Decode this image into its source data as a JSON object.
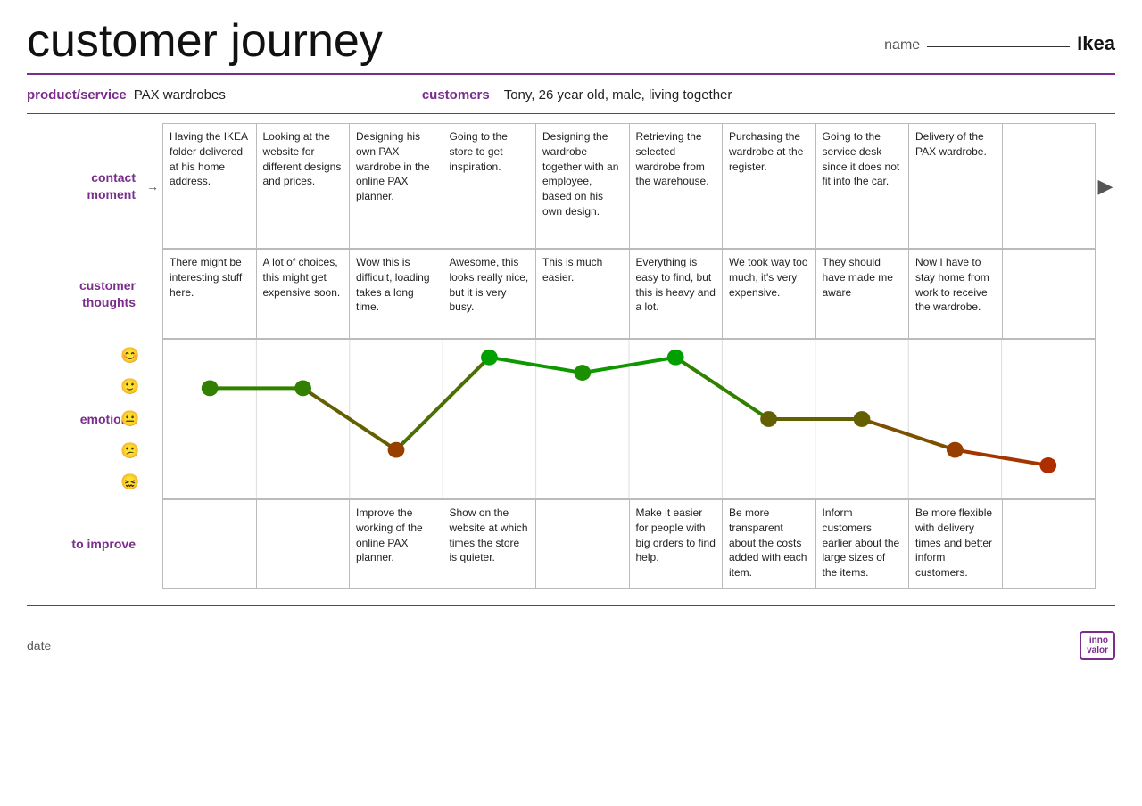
{
  "header": {
    "title": "customer journey",
    "name_label": "name",
    "name_value": "Ikea"
  },
  "meta": {
    "product_label": "product/service",
    "product_value": "PAX wardrobes",
    "customers_label": "customers",
    "customers_value": "Tony, 26 year old, male, living together"
  },
  "contact_moment_label": "contact\nmoment",
  "customer_thoughts_label": "customer\nthoughts",
  "emotions_label": "emotions",
  "to_improve_label": "to improve",
  "columns": [
    {
      "contact": "Having the IKEA folder delivered at his home address.",
      "thoughts": "There might be interesting stuff here.",
      "improve": ""
    },
    {
      "contact": "Looking at the website for different designs and prices.",
      "thoughts": "A lot of choices, this might get expensive soon.",
      "improve": ""
    },
    {
      "contact": "Designing his own PAX wardrobe in the online PAX planner.",
      "thoughts": "Wow this is difficult, loading takes a long time.",
      "improve": "Improve the working of the online PAX planner."
    },
    {
      "contact": "Going to the store to get inspiration.",
      "thoughts": "Awesome, this looks really nice, but it is very busy.",
      "improve": "Show on the website at which times the store is quieter."
    },
    {
      "contact": "Designing the wardrobe together with an employee, based on his own design.",
      "thoughts": "This is much easier.",
      "improve": ""
    },
    {
      "contact": "Retrieving the selected wardrobe from the warehouse.",
      "thoughts": "Everything is easy to find, but this is heavy and a lot.",
      "improve": "Make it easier for people with big orders to find help."
    },
    {
      "contact": "Purchasing the wardrobe at the register.",
      "thoughts": "We took way too much, it's very expensive.",
      "improve": "Be more transparent about the costs added with each item."
    },
    {
      "contact": "Going to the service desk since it does not fit into the car.",
      "thoughts": "They should have made me aware",
      "improve": "Inform customers earlier about the large sizes of the items."
    },
    {
      "contact": "Delivery of the PAX wardrobe.",
      "thoughts": "Now I have to stay home from work to receive the wardrobe.",
      "improve": "Be more flexible with delivery times and better inform customers."
    },
    {
      "contact": "",
      "thoughts": "",
      "improve": ""
    }
  ],
  "emotions": {
    "levels": [
      "😊",
      "🙂",
      "😐",
      "😕",
      "😖"
    ],
    "points": [
      {
        "col": 0,
        "level": 1
      },
      {
        "col": 1,
        "level": 1
      },
      {
        "col": 2,
        "level": 3
      },
      {
        "col": 3,
        "level": 0
      },
      {
        "col": 4,
        "level": 0.5
      },
      {
        "col": 5,
        "level": 0
      },
      {
        "col": 6,
        "level": 2
      },
      {
        "col": 7,
        "level": 2
      },
      {
        "col": 8,
        "level": 3
      },
      {
        "col": 9,
        "level": 3.5
      }
    ]
  },
  "footer": {
    "date_label": "date",
    "logo_line1": "inno",
    "logo_line2": "valor"
  }
}
